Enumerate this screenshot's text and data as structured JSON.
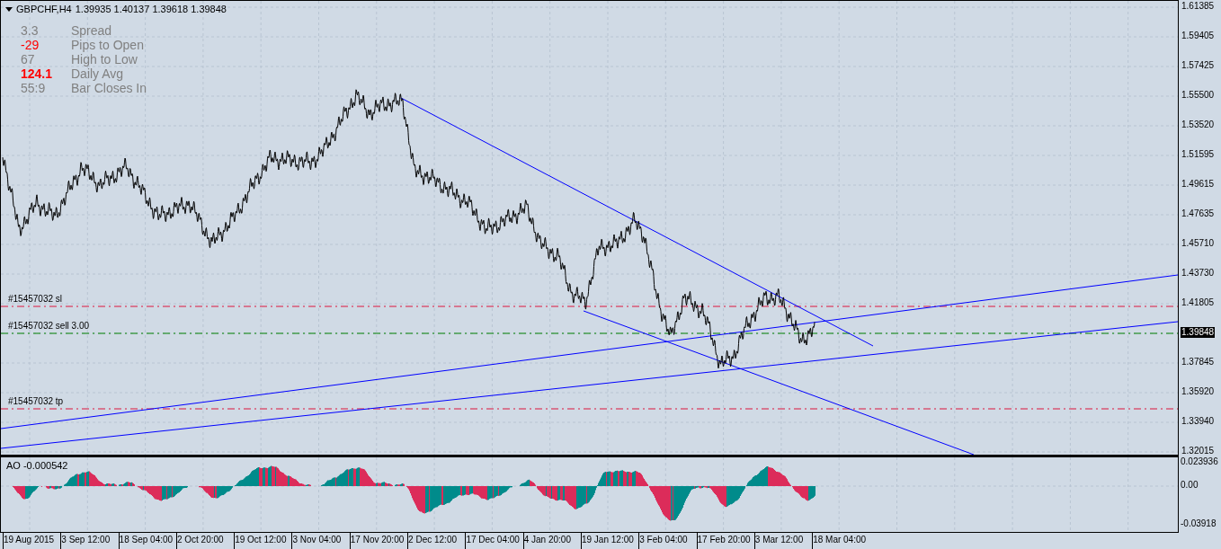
{
  "chart_header": {
    "symbol": "GBPCHF,H4",
    "quotes": "1.39935 1.40137 1.39618 1.39848"
  },
  "info_panel": [
    {
      "value": "3.3",
      "label": "Spread",
      "color": "#808080",
      "bold": false
    },
    {
      "value": "-29",
      "label": "Pips to Open",
      "color": "#ff0000",
      "bold": false
    },
    {
      "value": "67",
      "label": "High to Low",
      "color": "#808080",
      "bold": false
    },
    {
      "value": "124.1",
      "label": "Daily Avg",
      "color": "#ff0000",
      "bold": true
    },
    {
      "value": "55:9",
      "label": "Bar Closes In",
      "color": "#808080",
      "bold": false
    }
  ],
  "order_lines": [
    {
      "kind": "sl",
      "label": "#15457032 sl"
    },
    {
      "kind": "entry",
      "label": "#15457032 sell 3.00"
    },
    {
      "kind": "tp",
      "label": "#15457032 tp"
    }
  ],
  "price_axis": [
    {
      "text": "1.61385",
      "current": false
    },
    {
      "text": "1.59405",
      "current": false
    },
    {
      "text": "1.57425",
      "current": false
    },
    {
      "text": "1.55500",
      "current": false
    },
    {
      "text": "1.53520",
      "current": false
    },
    {
      "text": "1.51595",
      "current": false
    },
    {
      "text": "1.49615",
      "current": false
    },
    {
      "text": "1.47635",
      "current": false
    },
    {
      "text": "1.45710",
      "current": false
    },
    {
      "text": "1.43730",
      "current": false
    },
    {
      "text": "1.41805",
      "current": false
    },
    {
      "text": "1.39848",
      "current": true
    },
    {
      "text": "1.37845",
      "current": false
    },
    {
      "text": "1.35920",
      "current": false
    },
    {
      "text": "1.33940",
      "current": false
    },
    {
      "text": "1.32015",
      "current": false
    }
  ],
  "indicator": {
    "title": "AO -0.000542",
    "axis": [
      "0.023936",
      "0.00",
      "-0.03918"
    ]
  },
  "time_axis": [
    "19 Aug 2015",
    "3 Sep 12:00",
    "18 Sep 04:00",
    "2 Oct 20:00",
    "19 Oct 12:00",
    "3 Nov 04:00",
    "17 Nov 20:00",
    "2 Dec 12:00",
    "17 Dec 04:00",
    "4 Jan 20:00",
    "19 Jan 12:00",
    "3 Feb 04:00",
    "17 Feb 20:00",
    "3 Mar 12:00",
    "18 Mar 04:00"
  ]
}
